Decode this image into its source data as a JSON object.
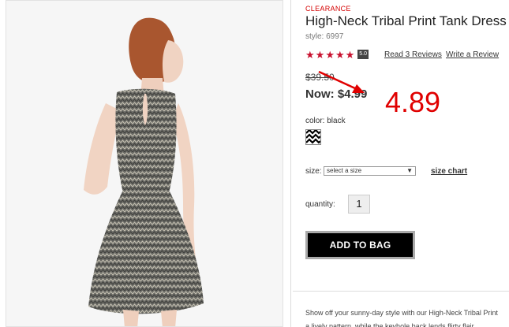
{
  "product": {
    "badge": "CLEARANCE",
    "title": "High-Neck Tribal Print Tank Dress",
    "style": "style: 6997",
    "rating_score": "5.0",
    "rating_stars": 5,
    "read_reviews": "Read 3 Reviews",
    "write_review": "Write a Review",
    "old_price": "$39.50",
    "now_label": "Now: $4.99",
    "color_label": "color: black",
    "size_label": "size:",
    "size_select_value": "select a size",
    "size_chart": "size chart",
    "quantity_label": "quantity:",
    "quantity_value": "1",
    "add_to_bag": "ADD TO BAG",
    "description_line1": "Show off your sunny-day style with our High-Neck Tribal Print",
    "description_line2": "a lively pattern, while the keyhole back lends flirty flair."
  },
  "annotation": {
    "text": "4.89",
    "color": "#e00000"
  },
  "colors": {
    "star": "#c8102e",
    "clearance": "#d40000",
    "button_bg": "#000000"
  },
  "icons": {
    "stars": "star-icon",
    "select": "chevron-down-icon",
    "swatch": "tribal-pattern-swatch",
    "arrow": "arrow-annotation"
  }
}
